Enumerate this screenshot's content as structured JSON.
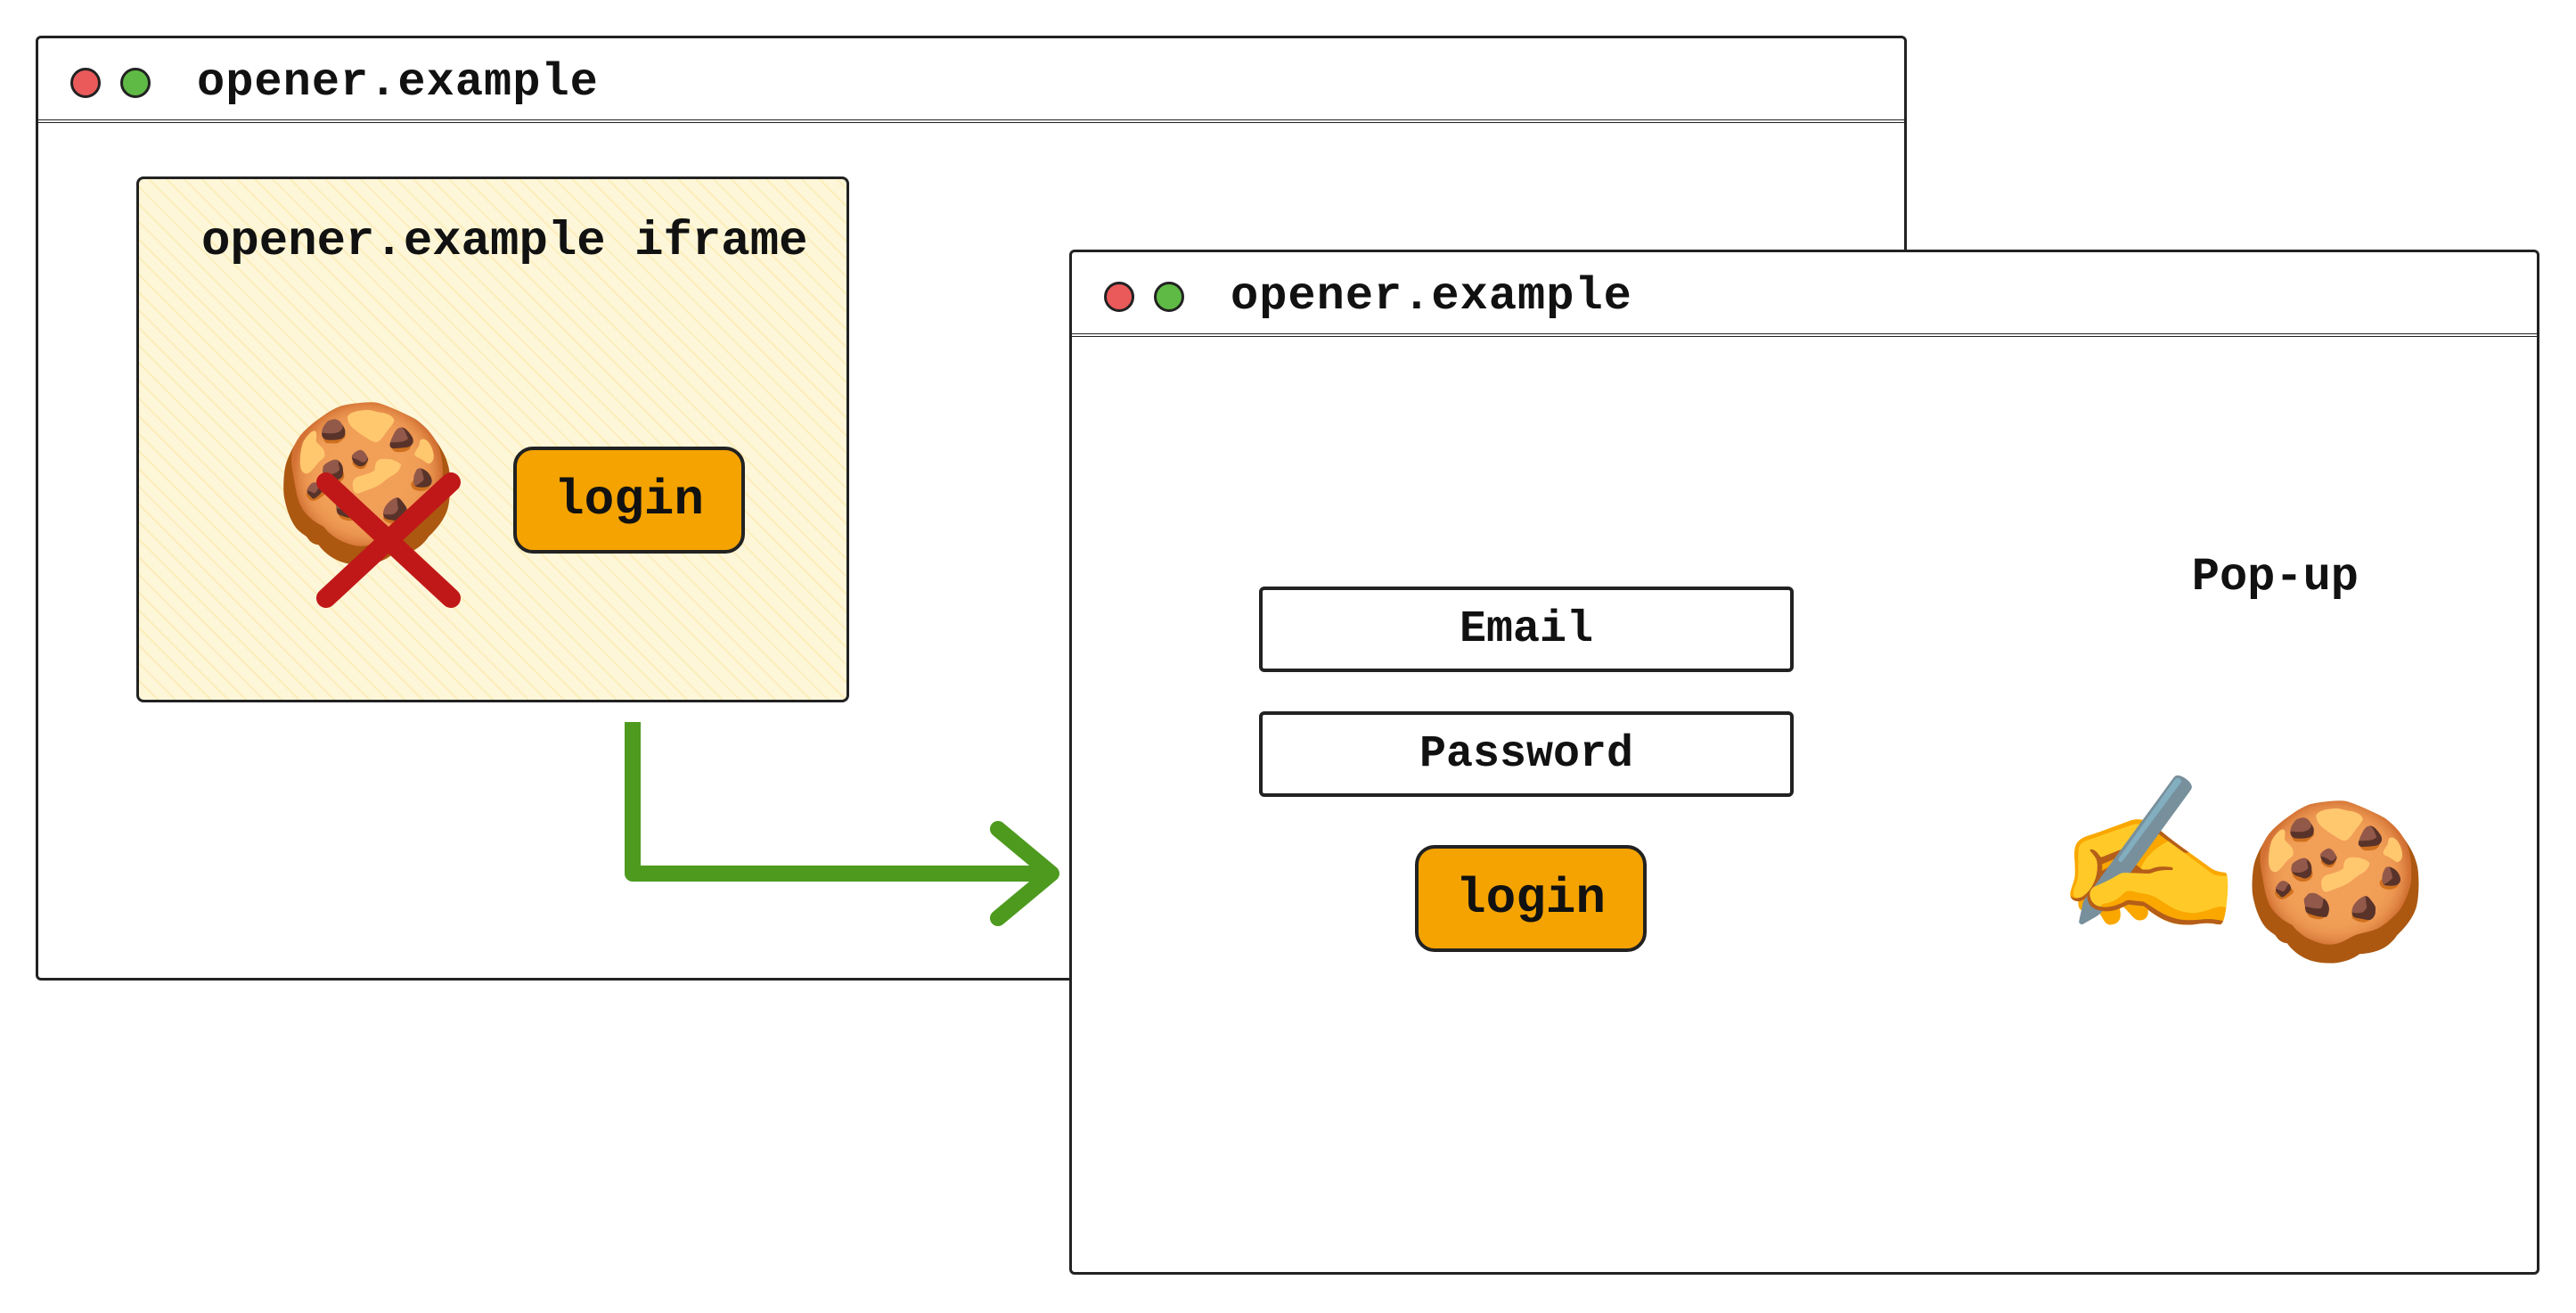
{
  "browser1": {
    "title": "opener.example",
    "iframe": {
      "label": "opener.example iframe",
      "login_button": "login",
      "cookie_icon": "🍪",
      "cross_icon": "❌"
    }
  },
  "browser2": {
    "title": "opener.example",
    "label": "Pop-up",
    "form": {
      "email_placeholder": "Email",
      "password_placeholder": "Password",
      "login_button": "login"
    },
    "writing_icon": "✍️",
    "cookie_icon": "🍪"
  }
}
